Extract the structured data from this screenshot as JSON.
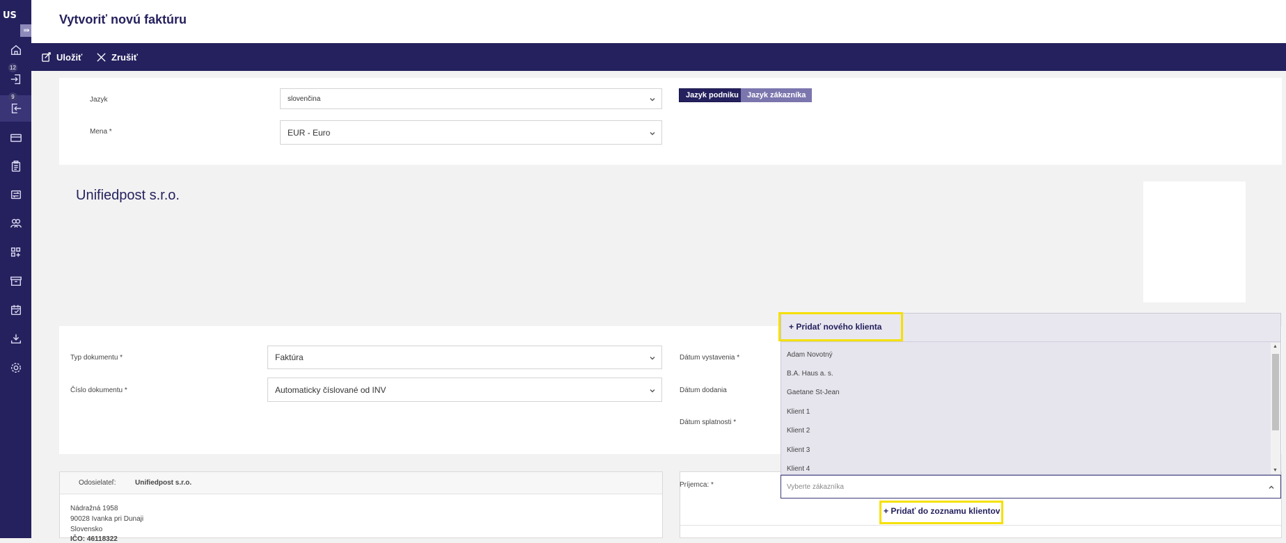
{
  "sidebar": {
    "logo": "US",
    "collapse_icon": "collapse-icon",
    "items": [
      {
        "name": "home",
        "icon": "home-icon"
      },
      {
        "name": "incoming",
        "icon": "inbox-icon",
        "badge": "12"
      },
      {
        "name": "outgoing",
        "icon": "outbox-icon",
        "badge": "9",
        "active": true
      },
      {
        "name": "payments",
        "icon": "card-icon"
      },
      {
        "name": "documents",
        "icon": "clipboard-icon"
      },
      {
        "name": "transfers",
        "icon": "transfer-icon"
      },
      {
        "name": "contacts",
        "icon": "users-icon"
      },
      {
        "name": "apps",
        "icon": "apps-icon"
      },
      {
        "name": "archive",
        "icon": "archive-icon"
      },
      {
        "name": "calendar",
        "icon": "calendar-icon"
      },
      {
        "name": "download",
        "icon": "download-icon"
      },
      {
        "name": "settings",
        "icon": "gear-icon"
      }
    ]
  },
  "header": {
    "title": "Vytvoriť novú faktúru"
  },
  "toolbar": {
    "save_label": "Uložiť",
    "cancel_label": "Zrušiť"
  },
  "language_panel": {
    "language_label": "Jazyk",
    "language_value": "slovenčina",
    "currency_label": "Mena *",
    "currency_value": "EUR - Euro",
    "company_language_btn": "Jazyk podniku",
    "customer_language_btn": "Jazyk zákazníka"
  },
  "company": {
    "name": "Unifiedpost s.r.o."
  },
  "document_panel": {
    "doc_type_label": "Typ dokumentu *",
    "doc_type_value": "Faktúra",
    "doc_number_label": "Číslo dokumentu *",
    "doc_number_value": "Automaticky číslované od INV",
    "issue_date_label": "Dátum vystavenia *",
    "delivery_date_label": "Dátum dodania",
    "due_date_label": "Dátum splatnosti *"
  },
  "sender": {
    "label": "Odosielateľ:",
    "name": "Unifiedpost s.r.o.",
    "street": "Nádražná 1958",
    "city": "90028 Ivanka pri Dunaji",
    "country": "Slovensko",
    "ico_partial": "IČO: 46118322"
  },
  "recipient": {
    "label": "Príjemca: *",
    "placeholder": "Vyberte zákazníka",
    "add_to_list_label": "Pridať do zoznamu klientov"
  },
  "dropdown": {
    "add_new_label": "Pridať nového klienta",
    "clients": [
      "Adam Novotný",
      "B.A. Haus a. s.",
      "Gaetane St-Jean",
      "Klient 1",
      "Klient 2",
      "Klient 3",
      "Klient 4"
    ]
  },
  "colors": {
    "primary": "#25215e",
    "secondary_button": "#7b76ad",
    "highlight": "#f5e000"
  }
}
